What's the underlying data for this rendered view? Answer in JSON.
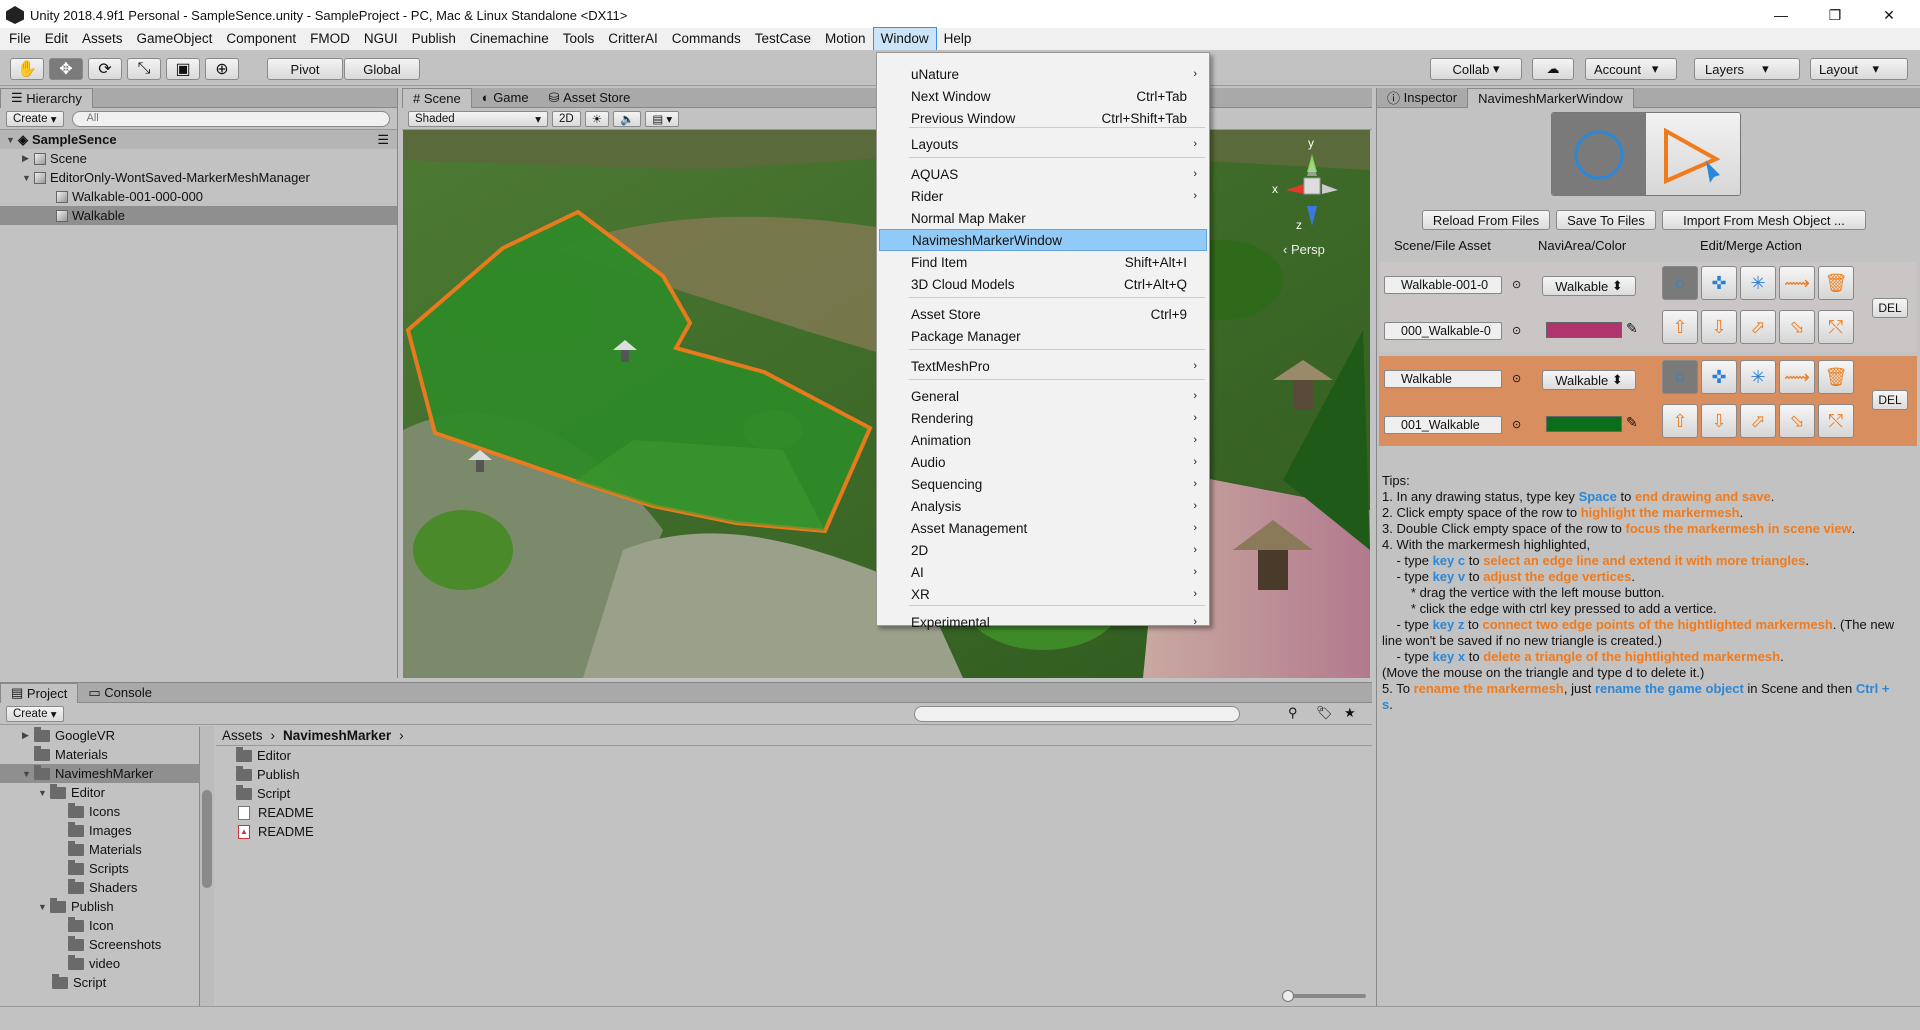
{
  "window": {
    "title": "Unity 2018.4.9f1 Personal - SampleSence.unity - SampleProject - PC, Mac & Linux Standalone <DX11>",
    "minimize": "—",
    "maximize": "❐",
    "close": "✕"
  },
  "menu": [
    "File",
    "Edit",
    "Assets",
    "GameObject",
    "Component",
    "FMOD",
    "NGUI",
    "Publish",
    "Cinemachine",
    "Tools",
    "CritterAI",
    "Commands",
    "TestCase",
    "Motion",
    "Window",
    "Help"
  ],
  "toolbar": {
    "pivot": "Pivot",
    "global": "Global",
    "collab": "Collab",
    "account": "Account",
    "layers": "Layers",
    "layout": "Layout"
  },
  "hierarchy": {
    "tab": "Hierarchy",
    "create": "Create",
    "search_placeholder": "All",
    "scene_name": "SampleSence",
    "items": [
      "Scene",
      "EditorOnly-WontSaved-MarkerMeshManager",
      "Walkable-001-000-000",
      "Walkable"
    ]
  },
  "scene_view": {
    "tabs": [
      "Scene",
      "Game",
      "Asset Store"
    ],
    "shading": "Shaded",
    "mode2d": "2D",
    "persp": "Persp",
    "gizmo_y": "y",
    "gizmo_x": "x",
    "gizmo_z": "z"
  },
  "window_menu": {
    "items": [
      {
        "label": "uNature",
        "shortcut": "",
        "submenu": true
      },
      {
        "label": "Next Window",
        "shortcut": "Ctrl+Tab",
        "submenu": false
      },
      {
        "label": "Previous Window",
        "shortcut": "Ctrl+Shift+Tab",
        "submenu": false
      },
      {
        "label": "Layouts",
        "shortcut": "",
        "submenu": true
      },
      {
        "label": "AQUAS",
        "shortcut": "",
        "submenu": true
      },
      {
        "label": "Rider",
        "shortcut": "",
        "submenu": true
      },
      {
        "label": "Normal Map Maker",
        "shortcut": "",
        "submenu": false
      },
      {
        "label": "NavimeshMarkerWindow",
        "shortcut": "",
        "submenu": false
      },
      {
        "label": "Find Item",
        "shortcut": "Shift+Alt+I",
        "submenu": false
      },
      {
        "label": "3D Cloud Models",
        "shortcut": "Ctrl+Alt+Q",
        "submenu": false
      },
      {
        "label": "Asset Store",
        "shortcut": "Ctrl+9",
        "submenu": false
      },
      {
        "label": "Package Manager",
        "shortcut": "",
        "submenu": false
      },
      {
        "label": "TextMeshPro",
        "shortcut": "",
        "submenu": true
      },
      {
        "label": "General",
        "shortcut": "",
        "submenu": true
      },
      {
        "label": "Rendering",
        "shortcut": "",
        "submenu": true
      },
      {
        "label": "Animation",
        "shortcut": "",
        "submenu": true
      },
      {
        "label": "Audio",
        "shortcut": "",
        "submenu": true
      },
      {
        "label": "Sequencing",
        "shortcut": "",
        "submenu": true
      },
      {
        "label": "Analysis",
        "shortcut": "",
        "submenu": true
      },
      {
        "label": "Asset Management",
        "shortcut": "",
        "submenu": true
      },
      {
        "label": "2D",
        "shortcut": "",
        "submenu": true
      },
      {
        "label": "AI",
        "shortcut": "",
        "submenu": true
      },
      {
        "label": "XR",
        "shortcut": "",
        "submenu": true
      },
      {
        "label": "Experimental",
        "shortcut": "",
        "submenu": true
      }
    ]
  },
  "inspector": {
    "tabs": [
      "Inspector",
      "NavimeshMarkerWindow"
    ],
    "buttons": [
      "Reload From Files",
      "Save To Files",
      "Import From Mesh Object ..."
    ],
    "columns": [
      "Scene/File Asset",
      "NaviArea/Color",
      "Edit/Merge Action"
    ],
    "rows": [
      {
        "scene_obj": "Walkable-001-0",
        "file": "000_Walkable-0",
        "area": "Walkable",
        "color": "#b0356e",
        "del": "DEL"
      },
      {
        "scene_obj": "Walkable",
        "file": "001_Walkable",
        "area": "Walkable",
        "color": "#0a6e1a",
        "del": "DEL"
      }
    ]
  },
  "tips": {
    "heading": "Tips:",
    "l1a": "1. In any drawing status, type key ",
    "l1b": "Space",
    "l1c": " to ",
    "l1d": "end drawing and save",
    "l1e": ".",
    "l2a": "2. Click empty space of the row to ",
    "l2b": "highlight the markermesh",
    "l2c": ".",
    "l3a": "3. Double Click empty space of the row to ",
    "l3b": "focus the markermesh in scene view",
    "l3c": ".",
    "l4": "4. With the markermesh highlighted,",
    "l5a": "    - type ",
    "l5b": "key c",
    "l5c": " to ",
    "l5d": "select an edge line and extend it with more triangles",
    "l5e": ".",
    "l6a": "    - type ",
    "l6b": "key v",
    "l6c": " to ",
    "l6d": "adjust the edge vertices",
    "l6e": ".",
    "l7": "        * drag the vertice with the left mouse button.",
    "l8": "        * click the edge with ctrl key pressed to add a vertice.",
    "l9a": "    - type ",
    "l9b": "key z",
    "l9c": " to ",
    "l9d": "connect two edge points of the hightlighted markermesh",
    "l9e": ". (The new line won't be saved if no new triangle is created.)",
    "l10a": "    - type ",
    "l10b": "key x",
    "l10c": " to ",
    "l10d": "delete a triangle of the hightlighted markermesh",
    "l10e": ".",
    "l11": "(Move the mouse on the triangle and type d to delete it.)",
    "l12a": "5. To ",
    "l12b": "rename the markermesh",
    "l12c": ", just ",
    "l12d": "rename the game object",
    "l12e": " in Scene and then ",
    "l12f": "Ctrl + s",
    "l12g": "."
  },
  "project": {
    "tabs": [
      "Project",
      "Console"
    ],
    "create": "Create",
    "tree": [
      {
        "label": "GoogleVR",
        "depth": 0,
        "arrow": "▶"
      },
      {
        "label": "Materials",
        "depth": 0,
        "arrow": ""
      },
      {
        "label": "NavimeshMarker",
        "depth": 0,
        "arrow": "▼"
      },
      {
        "label": "Editor",
        "depth": 1,
        "arrow": "▼"
      },
      {
        "label": "Icons",
        "depth": 2,
        "arrow": ""
      },
      {
        "label": "Images",
        "depth": 2,
        "arrow": ""
      },
      {
        "label": "Materials",
        "depth": 2,
        "arrow": ""
      },
      {
        "label": "Scripts",
        "depth": 2,
        "arrow": ""
      },
      {
        "label": "Shaders",
        "depth": 2,
        "arrow": ""
      },
      {
        "label": "Publish",
        "depth": 1,
        "arrow": "▼"
      },
      {
        "label": "Icon",
        "depth": 2,
        "arrow": ""
      },
      {
        "label": "Screenshots",
        "depth": 2,
        "arrow": ""
      },
      {
        "label": "video",
        "depth": 2,
        "arrow": ""
      },
      {
        "label": "Script",
        "depth": 1,
        "arrow": ""
      }
    ],
    "breadcrumb": [
      "Assets",
      "NavimeshMarker"
    ],
    "files": [
      {
        "label": "Editor",
        "kind": "folder"
      },
      {
        "label": "Publish",
        "kind": "folder"
      },
      {
        "label": "Script",
        "kind": "folder"
      },
      {
        "label": "README",
        "kind": "text"
      },
      {
        "label": "README",
        "kind": "pdf"
      }
    ]
  },
  "colors": {
    "accent": "#2b88d8",
    "highlight_orange": "#f07b1d",
    "selected_row": "#d98e60",
    "menu_highlight": "#91c9f7"
  }
}
